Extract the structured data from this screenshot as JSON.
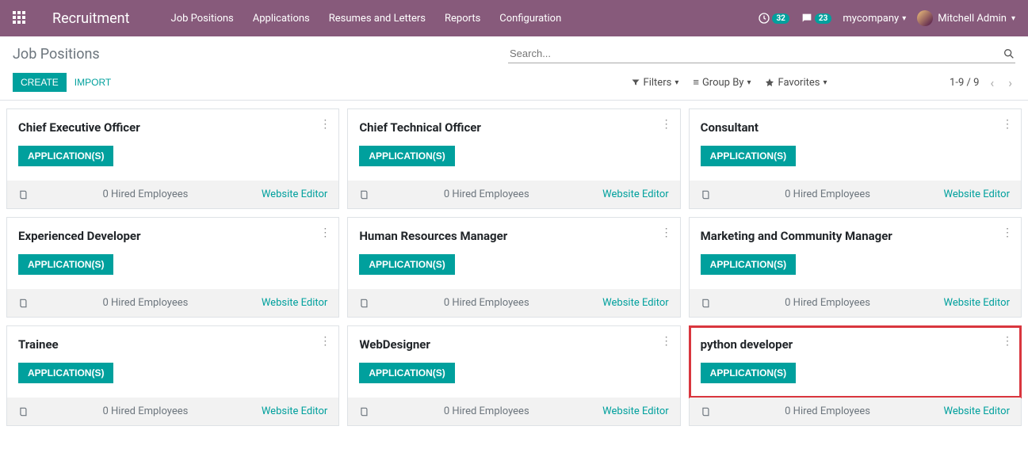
{
  "navbar": {
    "brand": "Recruitment",
    "menu": [
      "Job Positions",
      "Applications",
      "Resumes and Letters",
      "Reports",
      "Configuration"
    ],
    "activity_count": "32",
    "message_count": "23",
    "company": "mycompany",
    "user": "Mitchell Admin"
  },
  "breadcrumb": "Job Positions",
  "search": {
    "placeholder": "Search..."
  },
  "buttons": {
    "create": "Create",
    "import": "Import"
  },
  "filters": {
    "filters": "Filters",
    "groupby": "Group By",
    "favorites": "Favorites"
  },
  "pager": {
    "range": "1-9 / 9"
  },
  "card_labels": {
    "applications": "APPLICATION(S)",
    "website_editor": "Website Editor"
  },
  "cards": [
    {
      "title": "Chief Executive Officer",
      "hired": "0 Hired Employees",
      "highlight": false
    },
    {
      "title": "Chief Technical Officer",
      "hired": "0 Hired Employees",
      "highlight": false
    },
    {
      "title": "Consultant",
      "hired": "0 Hired Employees",
      "highlight": false
    },
    {
      "title": "Experienced Developer",
      "hired": "0 Hired Employees",
      "highlight": false
    },
    {
      "title": "Human Resources Manager",
      "hired": "0 Hired Employees",
      "highlight": false
    },
    {
      "title": "Marketing and Community Manager",
      "hired": "0 Hired Employees",
      "highlight": false
    },
    {
      "title": "Trainee",
      "hired": "0 Hired Employees",
      "highlight": false
    },
    {
      "title": "WebDesigner",
      "hired": "0 Hired Employees",
      "highlight": false
    },
    {
      "title": "python developer",
      "hired": "0 Hired Employees",
      "highlight": true
    }
  ]
}
